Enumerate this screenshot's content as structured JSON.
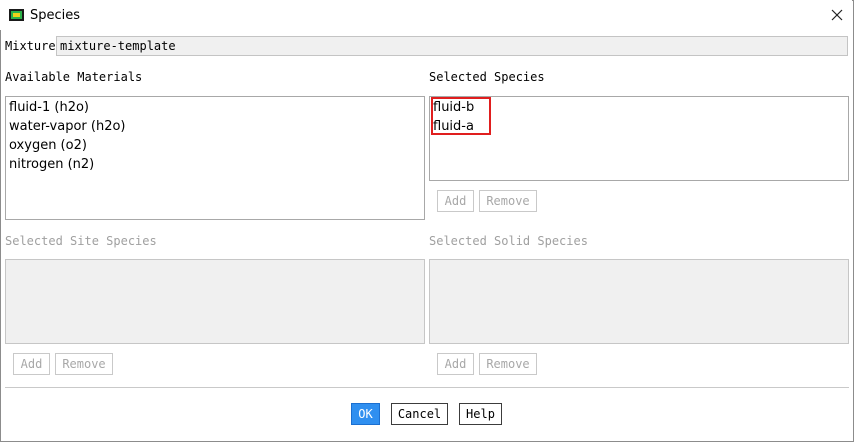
{
  "window": {
    "title": "Species",
    "icon": "app-icon",
    "close_icon": "close-icon"
  },
  "mixture": {
    "label": "Mixture",
    "value": "mixture-template"
  },
  "available_materials": {
    "label": "Available Materials",
    "items": [
      "fluid-1 (h2o)",
      "water-vapor (h2o)",
      "oxygen (o2)",
      "nitrogen (n2)"
    ]
  },
  "selected_species": {
    "label": "Selected Species",
    "items": [
      "fluid-b",
      "fluid-a"
    ],
    "add_label": "Add",
    "remove_label": "Remove"
  },
  "selected_site_species": {
    "label": "Selected Site Species",
    "items": [],
    "add_label": "Add",
    "remove_label": "Remove"
  },
  "selected_solid_species": {
    "label": "Selected Solid Species",
    "items": [],
    "add_label": "Add",
    "remove_label": "Remove"
  },
  "footer": {
    "ok_label": "OK",
    "cancel_label": "Cancel",
    "help_label": "Help"
  },
  "colors": {
    "highlight": "#e01e1e",
    "ok_button": "#2f8ff0",
    "disabled_text": "#a0a0a0"
  }
}
